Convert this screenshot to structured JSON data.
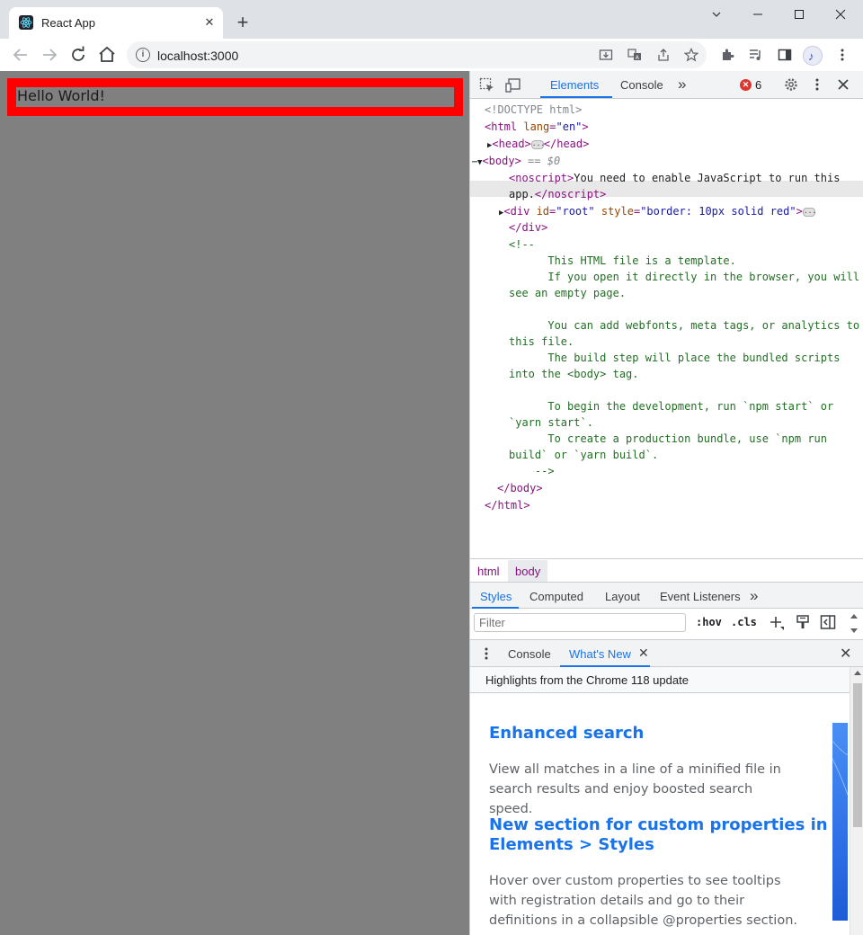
{
  "browser": {
    "tab_title": "React App",
    "tab_close": "✕",
    "new_tab": "+",
    "url": "localhost:3000",
    "info_glyph": "i"
  },
  "page": {
    "root_text": "Hello World!",
    "root_border_color": "#ff0000",
    "background": "#808080"
  },
  "devtools": {
    "tabs": [
      "Elements",
      "Console"
    ],
    "active_tab": "Elements",
    "more_tabs": "»",
    "error_count": "6",
    "dom": {
      "doctype": "<!DOCTYPE html>",
      "html_open": "<html",
      "html_lang_name": "lang",
      "html_lang_value": "\"en\"",
      "head_open": "<head>",
      "head_close": "</head>",
      "body_open": "<body>",
      "selected_marker": "== $0",
      "noscript_open": "<noscript>",
      "noscript_text_1": "You need to enable JavaScript to run this",
      "noscript_text_2": "app.",
      "noscript_close": "</noscript>",
      "div_open": "<div",
      "div_id_name": "id",
      "div_id_value": "\"root\"",
      "div_style_name": "style",
      "div_style_value": "\"border: 10px solid red\"",
      "div_close": "</div>",
      "comment_lines": [
        "<!--",
        "      This HTML file is a template.",
        "      If you open it directly in the browser, you will",
        "see an empty page.",
        "",
        "      You can add webfonts, meta tags, or analytics to",
        "this file.",
        "      The build step will place the bundled scripts",
        "into the <body> tag.",
        "",
        "      To begin the development, run `npm start` or",
        "`yarn start`.",
        "      To create a production bundle, use `npm run",
        "build` or `yarn build`.",
        "    -->"
      ],
      "body_close": "</body>",
      "html_close": "</html>"
    },
    "breadcrumbs": [
      "html",
      "body"
    ],
    "styles_tabs": [
      "Styles",
      "Computed",
      "Layout",
      "Event Listeners"
    ],
    "styles_more": "»",
    "filter_placeholder": "Filter",
    "hov_label": ":hov",
    "cls_label": ".cls",
    "drawer_tabs": [
      "Console",
      "What's New"
    ],
    "drawer_tab_close": "✕",
    "drawer_close": "✕",
    "whats_new": {
      "header": "Highlights from the Chrome 118 update",
      "items": [
        {
          "title_1": "Enhanced search",
          "body_1": "View all matches in a line of a minified file in",
          "body_2": "search results and enjoy boosted search speed."
        },
        {
          "title_1": "New section for custom properties in",
          "title_2": "Elements > Styles",
          "body_1": "Hover over custom properties to see tooltips",
          "body_2": "with registration details and go to their",
          "body_3": "definitions in a collapsible @properties section."
        }
      ]
    }
  },
  "colors": {
    "accent": "#1a73e8",
    "error": "#dc362e",
    "tag": "#881280",
    "comment": "#236e25"
  }
}
